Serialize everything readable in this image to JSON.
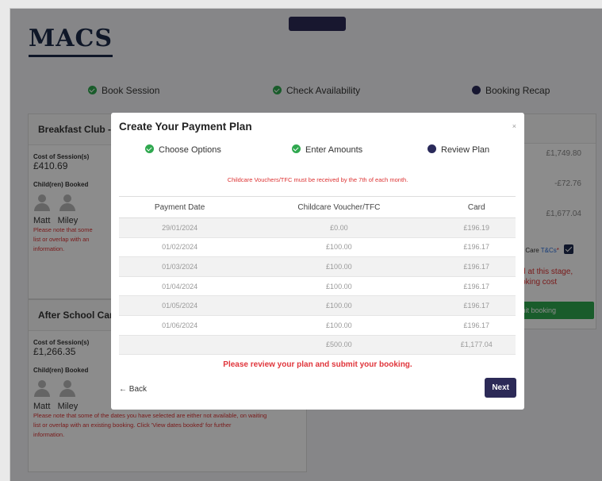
{
  "brand": {
    "logo": "MACS"
  },
  "steps": [
    {
      "label": "Book Session",
      "state": "done"
    },
    {
      "label": "Check Availability",
      "state": "done"
    },
    {
      "label": "Booking Recap",
      "state": "current"
    }
  ],
  "cards": {
    "breakfast": {
      "title": "Breakfast Club -",
      "cost_label": "Cost of Session(s)",
      "cost": "£410.69",
      "children_label": "Child(ren) Booked",
      "child1": "Matt",
      "child2": "Miley",
      "warn1": "Please note that some",
      "warn2": "list or overlap with an",
      "warn3": "information."
    },
    "after_school": {
      "title": "After School Car",
      "cost_label": "Cost of Session(s)",
      "cost": "£1,266.35",
      "children_label": "Child(ren) Booked",
      "child1": "Matt",
      "child2": "Miley",
      "warn1": "Please note that some of the dates you have selected are either not available, on waiting",
      "warn2": "list or overlap with an existing booking. Click 'View dates booked' for further",
      "warn3": "information."
    }
  },
  "summary": {
    "total": "£1,749.80",
    "discount": "-£72.76",
    "net": "£1,677.04",
    "terms_prefix": "hool Care",
    "terms_link": "T&Cs",
    "terms_star": "*",
    "required1": "ired at this stage,",
    "required2": "booking cost",
    "submit": "mit booking"
  },
  "modal": {
    "title": "Create Your Payment Plan",
    "close": "×",
    "steps": [
      {
        "label": "Choose Options",
        "state": "done"
      },
      {
        "label": "Enter Amounts",
        "state": "done"
      },
      {
        "label": "Review Plan",
        "state": "current"
      }
    ],
    "notice": "Childcare Vouchers/TFC must be received by the 7th of each month.",
    "columns": [
      "Payment Date",
      "Childcare Voucher/TFC",
      "Card"
    ],
    "rows": [
      [
        "29/01/2024",
        "£0.00",
        "£196.19"
      ],
      [
        "01/02/2024",
        "£100.00",
        "£196.17"
      ],
      [
        "01/03/2024",
        "£100.00",
        "£196.17"
      ],
      [
        "01/04/2024",
        "£100.00",
        "£196.17"
      ],
      [
        "01/05/2024",
        "£100.00",
        "£196.17"
      ],
      [
        "01/06/2024",
        "£100.00",
        "£196.17"
      ],
      [
        "",
        "£500.00",
        "£1,177.04"
      ]
    ],
    "review_message": "Please review your plan and submit your booking.",
    "back_label": "← Back",
    "next_label": "Next"
  },
  "colors": {
    "accent": "#2c2a57",
    "success": "#2fa84f",
    "warning": "#e0353b"
  }
}
